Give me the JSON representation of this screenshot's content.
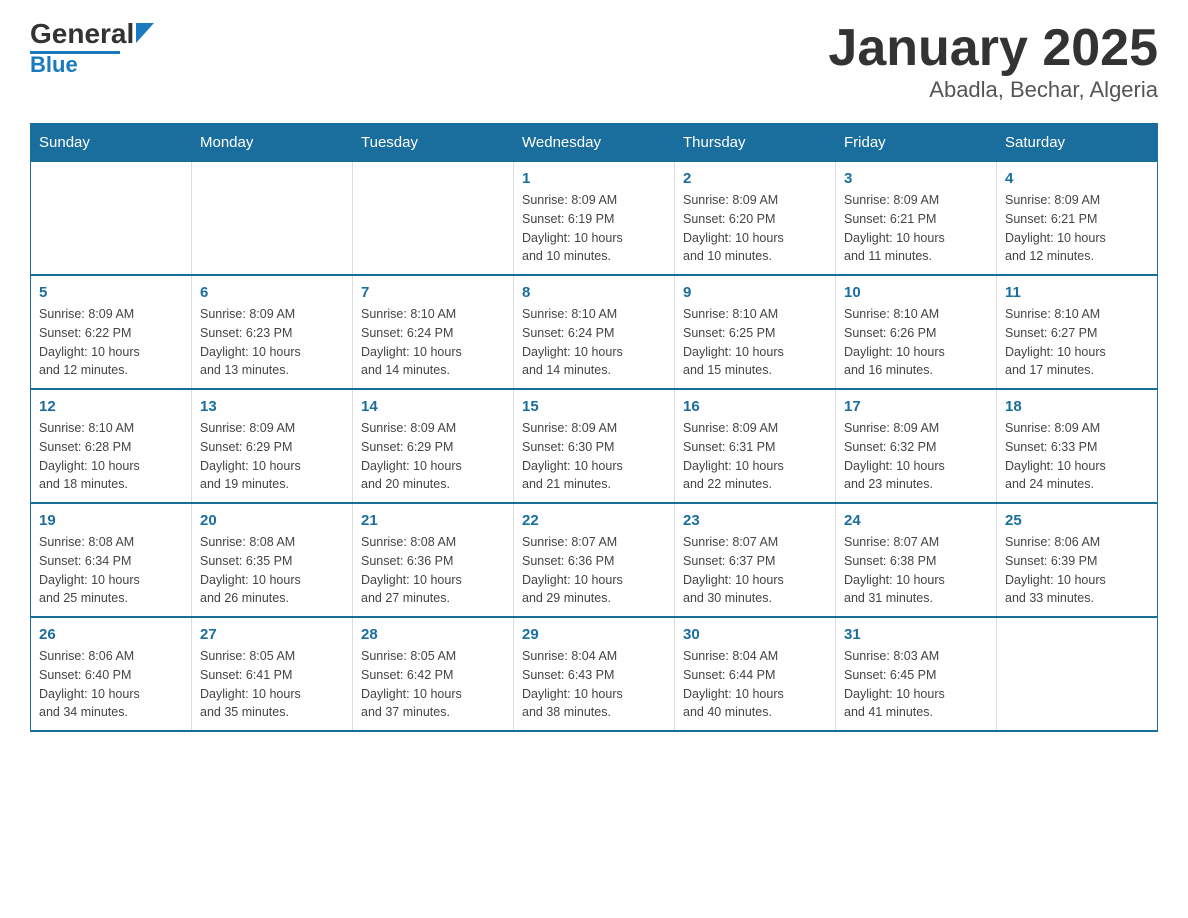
{
  "header": {
    "logo_text_general": "General",
    "logo_text_blue": "Blue",
    "title": "January 2025",
    "subtitle": "Abadla, Bechar, Algeria"
  },
  "days_header": [
    "Sunday",
    "Monday",
    "Tuesday",
    "Wednesday",
    "Thursday",
    "Friday",
    "Saturday"
  ],
  "weeks": [
    {
      "days": [
        {
          "num": "",
          "info": ""
        },
        {
          "num": "",
          "info": ""
        },
        {
          "num": "",
          "info": ""
        },
        {
          "num": "1",
          "info": "Sunrise: 8:09 AM\nSunset: 6:19 PM\nDaylight: 10 hours\nand 10 minutes."
        },
        {
          "num": "2",
          "info": "Sunrise: 8:09 AM\nSunset: 6:20 PM\nDaylight: 10 hours\nand 10 minutes."
        },
        {
          "num": "3",
          "info": "Sunrise: 8:09 AM\nSunset: 6:21 PM\nDaylight: 10 hours\nand 11 minutes."
        },
        {
          "num": "4",
          "info": "Sunrise: 8:09 AM\nSunset: 6:21 PM\nDaylight: 10 hours\nand 12 minutes."
        }
      ]
    },
    {
      "days": [
        {
          "num": "5",
          "info": "Sunrise: 8:09 AM\nSunset: 6:22 PM\nDaylight: 10 hours\nand 12 minutes."
        },
        {
          "num": "6",
          "info": "Sunrise: 8:09 AM\nSunset: 6:23 PM\nDaylight: 10 hours\nand 13 minutes."
        },
        {
          "num": "7",
          "info": "Sunrise: 8:10 AM\nSunset: 6:24 PM\nDaylight: 10 hours\nand 14 minutes."
        },
        {
          "num": "8",
          "info": "Sunrise: 8:10 AM\nSunset: 6:24 PM\nDaylight: 10 hours\nand 14 minutes."
        },
        {
          "num": "9",
          "info": "Sunrise: 8:10 AM\nSunset: 6:25 PM\nDaylight: 10 hours\nand 15 minutes."
        },
        {
          "num": "10",
          "info": "Sunrise: 8:10 AM\nSunset: 6:26 PM\nDaylight: 10 hours\nand 16 minutes."
        },
        {
          "num": "11",
          "info": "Sunrise: 8:10 AM\nSunset: 6:27 PM\nDaylight: 10 hours\nand 17 minutes."
        }
      ]
    },
    {
      "days": [
        {
          "num": "12",
          "info": "Sunrise: 8:10 AM\nSunset: 6:28 PM\nDaylight: 10 hours\nand 18 minutes."
        },
        {
          "num": "13",
          "info": "Sunrise: 8:09 AM\nSunset: 6:29 PM\nDaylight: 10 hours\nand 19 minutes."
        },
        {
          "num": "14",
          "info": "Sunrise: 8:09 AM\nSunset: 6:29 PM\nDaylight: 10 hours\nand 20 minutes."
        },
        {
          "num": "15",
          "info": "Sunrise: 8:09 AM\nSunset: 6:30 PM\nDaylight: 10 hours\nand 21 minutes."
        },
        {
          "num": "16",
          "info": "Sunrise: 8:09 AM\nSunset: 6:31 PM\nDaylight: 10 hours\nand 22 minutes."
        },
        {
          "num": "17",
          "info": "Sunrise: 8:09 AM\nSunset: 6:32 PM\nDaylight: 10 hours\nand 23 minutes."
        },
        {
          "num": "18",
          "info": "Sunrise: 8:09 AM\nSunset: 6:33 PM\nDaylight: 10 hours\nand 24 minutes."
        }
      ]
    },
    {
      "days": [
        {
          "num": "19",
          "info": "Sunrise: 8:08 AM\nSunset: 6:34 PM\nDaylight: 10 hours\nand 25 minutes."
        },
        {
          "num": "20",
          "info": "Sunrise: 8:08 AM\nSunset: 6:35 PM\nDaylight: 10 hours\nand 26 minutes."
        },
        {
          "num": "21",
          "info": "Sunrise: 8:08 AM\nSunset: 6:36 PM\nDaylight: 10 hours\nand 27 minutes."
        },
        {
          "num": "22",
          "info": "Sunrise: 8:07 AM\nSunset: 6:36 PM\nDaylight: 10 hours\nand 29 minutes."
        },
        {
          "num": "23",
          "info": "Sunrise: 8:07 AM\nSunset: 6:37 PM\nDaylight: 10 hours\nand 30 minutes."
        },
        {
          "num": "24",
          "info": "Sunrise: 8:07 AM\nSunset: 6:38 PM\nDaylight: 10 hours\nand 31 minutes."
        },
        {
          "num": "25",
          "info": "Sunrise: 8:06 AM\nSunset: 6:39 PM\nDaylight: 10 hours\nand 33 minutes."
        }
      ]
    },
    {
      "days": [
        {
          "num": "26",
          "info": "Sunrise: 8:06 AM\nSunset: 6:40 PM\nDaylight: 10 hours\nand 34 minutes."
        },
        {
          "num": "27",
          "info": "Sunrise: 8:05 AM\nSunset: 6:41 PM\nDaylight: 10 hours\nand 35 minutes."
        },
        {
          "num": "28",
          "info": "Sunrise: 8:05 AM\nSunset: 6:42 PM\nDaylight: 10 hours\nand 37 minutes."
        },
        {
          "num": "29",
          "info": "Sunrise: 8:04 AM\nSunset: 6:43 PM\nDaylight: 10 hours\nand 38 minutes."
        },
        {
          "num": "30",
          "info": "Sunrise: 8:04 AM\nSunset: 6:44 PM\nDaylight: 10 hours\nand 40 minutes."
        },
        {
          "num": "31",
          "info": "Sunrise: 8:03 AM\nSunset: 6:45 PM\nDaylight: 10 hours\nand 41 minutes."
        },
        {
          "num": "",
          "info": ""
        }
      ]
    }
  ]
}
